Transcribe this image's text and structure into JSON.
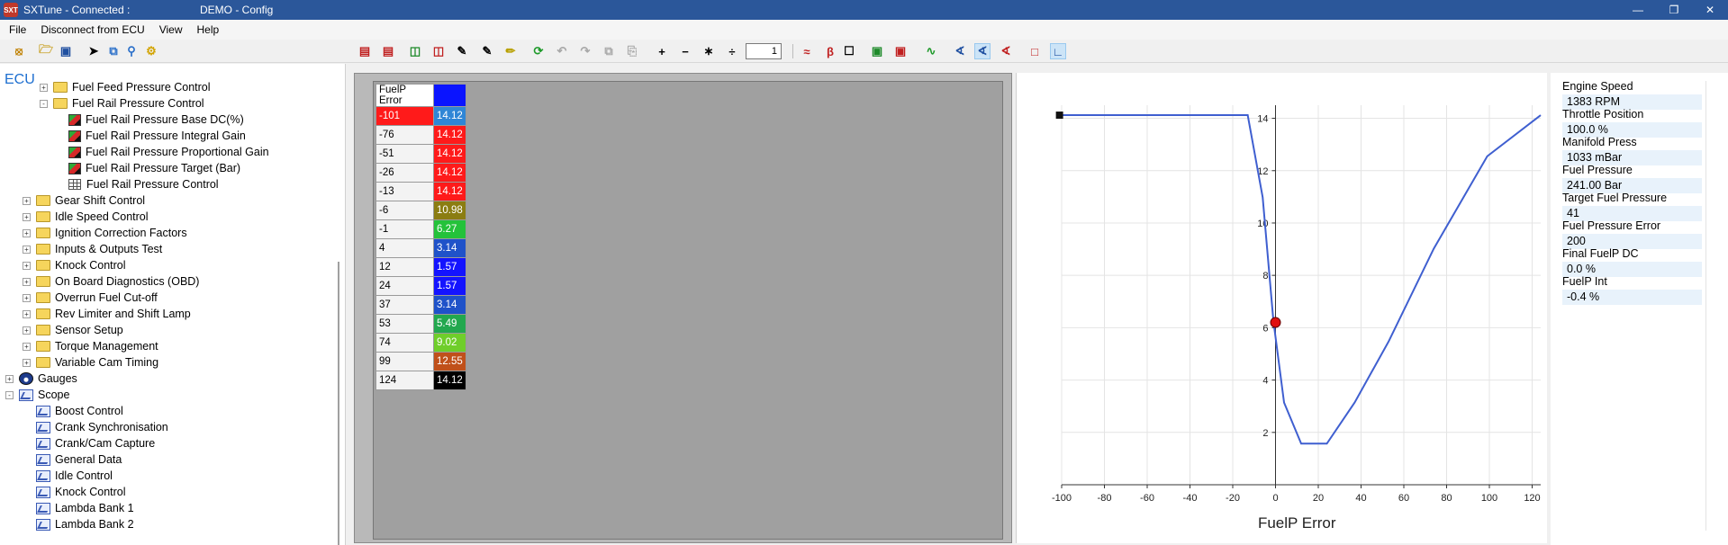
{
  "window": {
    "app_title": "SXTune - Connected :",
    "doc_title": "DEMO - Config",
    "logo_text": "SXT"
  },
  "menu": [
    "File",
    "Disconnect from ECU",
    "View",
    "Help"
  ],
  "toolbar": {
    "step_value": "1"
  },
  "tree": {
    "root": "ECU",
    "items": [
      {
        "label": "Fuel Feed Pressure Control",
        "icon": "folder-icon",
        "level": 2,
        "expander": "+"
      },
      {
        "label": "Fuel Rail Pressure Control",
        "icon": "folder-icon",
        "level": 2,
        "expander": "-"
      },
      {
        "label": "Fuel Rail Pressure Base DC(%)",
        "icon": "cube-icon",
        "level": 3,
        "expander": ""
      },
      {
        "label": "Fuel Rail Pressure Integral Gain",
        "icon": "cube-icon",
        "level": 3,
        "expander": ""
      },
      {
        "label": "Fuel Rail Pressure Proportional Gain",
        "icon": "cube-icon",
        "level": 3,
        "expander": ""
      },
      {
        "label": "Fuel Rail Pressure Target (Bar)",
        "icon": "cube-icon",
        "level": 3,
        "expander": ""
      },
      {
        "label": "Fuel Rail Pressure Control",
        "icon": "table-icon",
        "level": 3,
        "expander": ""
      },
      {
        "label": "Gear Shift Control",
        "icon": "folder-icon",
        "level": 1,
        "expander": "+"
      },
      {
        "label": "Idle Speed Control",
        "icon": "folder-icon",
        "level": 1,
        "expander": "+"
      },
      {
        "label": "Ignition Correction Factors",
        "icon": "folder-icon",
        "level": 1,
        "expander": "+"
      },
      {
        "label": "Inputs & Outputs Test",
        "icon": "folder-icon",
        "level": 1,
        "expander": "+"
      },
      {
        "label": "Knock Control",
        "icon": "folder-icon",
        "level": 1,
        "expander": "+"
      },
      {
        "label": "On Board Diagnostics (OBD)",
        "icon": "folder-icon",
        "level": 1,
        "expander": "+"
      },
      {
        "label": "Overrun Fuel Cut-off",
        "icon": "folder-icon",
        "level": 1,
        "expander": "+"
      },
      {
        "label": "Rev Limiter and Shift Lamp",
        "icon": "folder-icon",
        "level": 1,
        "expander": "+"
      },
      {
        "label": "Sensor Setup",
        "icon": "folder-icon",
        "level": 1,
        "expander": "+"
      },
      {
        "label": "Torque Management",
        "icon": "folder-icon",
        "level": 1,
        "expander": "+"
      },
      {
        "label": "Variable Cam Timing",
        "icon": "folder-icon",
        "level": 1,
        "expander": "+"
      },
      {
        "label": "Gauges",
        "icon": "gauge-icon",
        "level": 0,
        "expander": "+"
      },
      {
        "label": "Scope",
        "icon": "scope-icon",
        "level": 0,
        "expander": "-"
      },
      {
        "label": "Boost Control",
        "icon": "scope-icon",
        "level": 1,
        "expander": ""
      },
      {
        "label": "Crank Synchronisation",
        "icon": "scope-icon",
        "level": 1,
        "expander": ""
      },
      {
        "label": "Crank/Cam Capture",
        "icon": "scope-icon",
        "level": 1,
        "expander": ""
      },
      {
        "label": "General Data",
        "icon": "scope-icon",
        "level": 1,
        "expander": ""
      },
      {
        "label": "Idle Control",
        "icon": "scope-icon",
        "level": 1,
        "expander": ""
      },
      {
        "label": "Knock Control",
        "icon": "scope-icon",
        "level": 1,
        "expander": ""
      },
      {
        "label": "Lambda Bank 1",
        "icon": "scope-icon",
        "level": 1,
        "expander": ""
      },
      {
        "label": "Lambda Bank 2",
        "icon": "scope-icon",
        "level": 1,
        "expander": ""
      }
    ]
  },
  "table": {
    "header": "FuelP Error",
    "header_color": "#0a14ff",
    "rows": [
      {
        "x": "-101",
        "v": "14.12",
        "xcolor": "#ff1a1a",
        "vcolor": "#2f86d6"
      },
      {
        "x": "-76",
        "v": "14.12",
        "xcolor": "",
        "vcolor": "#ff1a1a"
      },
      {
        "x": "-51",
        "v": "14.12",
        "xcolor": "",
        "vcolor": "#ff1a1a"
      },
      {
        "x": "-26",
        "v": "14.12",
        "xcolor": "",
        "vcolor": "#ff1a1a"
      },
      {
        "x": "-13",
        "v": "14.12",
        "xcolor": "",
        "vcolor": "#ff1a1a"
      },
      {
        "x": "-6",
        "v": "10.98",
        "xcolor": "",
        "vcolor": "#8b7d12"
      },
      {
        "x": "-1",
        "v": "6.27",
        "xcolor": "",
        "vcolor": "#24c23a"
      },
      {
        "x": "4",
        "v": "3.14",
        "xcolor": "",
        "vcolor": "#1f52c9"
      },
      {
        "x": "12",
        "v": "1.57",
        "xcolor": "",
        "vcolor": "#1414ff"
      },
      {
        "x": "24",
        "v": "1.57",
        "xcolor": "",
        "vcolor": "#1414ff"
      },
      {
        "x": "37",
        "v": "3.14",
        "xcolor": "",
        "vcolor": "#1f52c9"
      },
      {
        "x": "53",
        "v": "5.49",
        "xcolor": "",
        "vcolor": "#22a84e"
      },
      {
        "x": "74",
        "v": "9.02",
        "xcolor": "",
        "vcolor": "#6fce2a"
      },
      {
        "x": "99",
        "v": "12.55",
        "xcolor": "",
        "vcolor": "#c0501a"
      },
      {
        "x": "124",
        "v": "14.12",
        "xcolor": "",
        "vcolor": "#000000"
      }
    ]
  },
  "chart_data": {
    "type": "line",
    "xlabel": "FuelP Error",
    "xlim": [
      -100,
      124
    ],
    "ylim": [
      0,
      14.5
    ],
    "xticks": [
      -100,
      -80,
      -60,
      -40,
      -20,
      0,
      20,
      40,
      60,
      80,
      100,
      120
    ],
    "yticks": [
      2,
      4,
      6,
      8,
      10,
      12,
      14
    ],
    "x": [
      -101,
      -76,
      -51,
      -26,
      -13,
      -6,
      -1,
      4,
      12,
      24,
      37,
      53,
      74,
      99,
      124
    ],
    "y": [
      14.12,
      14.12,
      14.12,
      14.12,
      14.12,
      10.98,
      6.27,
      3.14,
      1.57,
      1.57,
      3.14,
      5.49,
      9.02,
      12.55,
      14.12
    ],
    "cursor": {
      "x": 0,
      "y": 6.2
    },
    "grid": true,
    "line_color": "#3f5fd0",
    "cursor_color": "#e01010"
  },
  "gauges": [
    {
      "label": "Engine Speed",
      "value": "1383 RPM"
    },
    {
      "label": "Throttle Position",
      "value": "100.0 %"
    },
    {
      "label": "Manifold Press",
      "value": "1033 mBar"
    },
    {
      "label": "Fuel Pressure",
      "value": "241.00 Bar"
    },
    {
      "label": "Target Fuel Pressure",
      "value": "41"
    },
    {
      "label": "Fuel Pressure Error",
      "value": "200"
    },
    {
      "label": "Final FuelP DC",
      "value": "0.0 %"
    },
    {
      "label": "FuelP Int",
      "value": "-0.4 %"
    }
  ]
}
